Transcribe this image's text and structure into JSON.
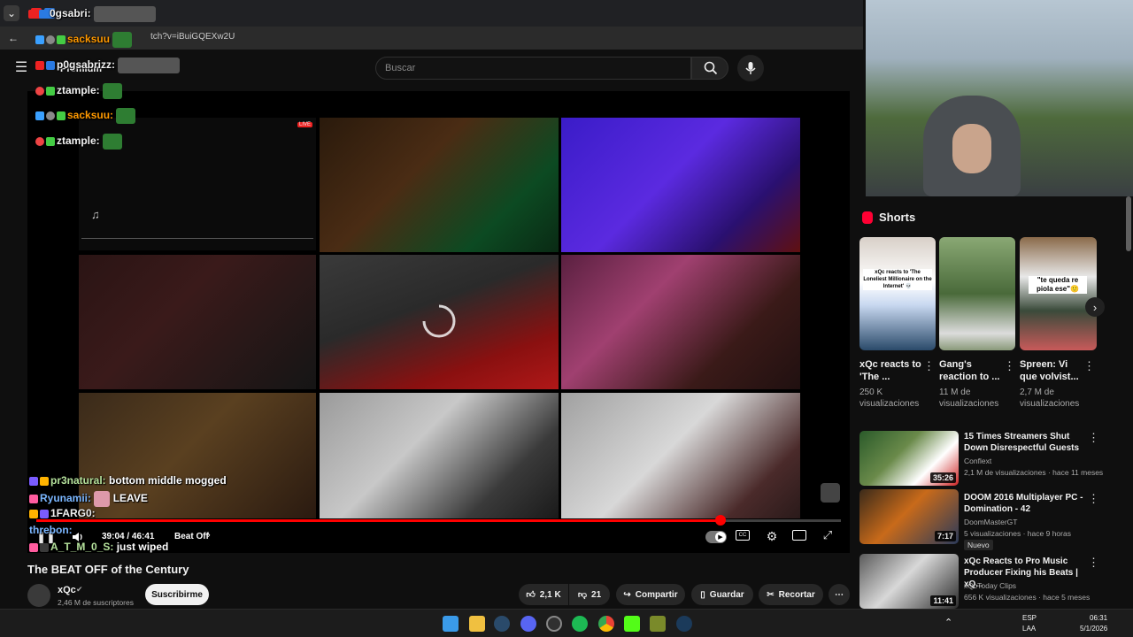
{
  "browser": {
    "tab_title": "0gsabri",
    "address": "tch?v=iBuiGQEXw2U"
  },
  "header": {
    "search_placeholder": "Buscar",
    "premium_label": "Premium"
  },
  "chat_top": [
    {
      "user": "0gsabri:",
      "color": "#ffffff"
    },
    {
      "user": "sacksuu",
      "color": "#ff9900"
    },
    {
      "user": "p0gsabrizz:",
      "color": "#ffffff"
    },
    {
      "user": "ztample:",
      "color": "#ffffff"
    },
    {
      "user": "sacksuu:",
      "color": "#ff9900"
    },
    {
      "user": "ztample:",
      "color": "#ffffff"
    }
  ],
  "chat_bottom": [
    {
      "user": "pr3natural:",
      "message": "bottom middle mogged",
      "color": "#b4e09b"
    },
    {
      "user": "Ryunamii:",
      "message": "LEAVE",
      "color": "#7ab6ff"
    },
    {
      "user": "1FARG0:",
      "message": "",
      "color": "#ffffff"
    },
    {
      "user": "threbon:",
      "message": "",
      "color": "#7ab6ff"
    },
    {
      "user": "A_T_M_0_S:",
      "message": "just wiped",
      "color": "#b4e09b"
    }
  ],
  "player": {
    "time": "39:04 / 46:41",
    "chapter": "Beat Off",
    "progress": 0.85,
    "live_badge": "LIVE"
  },
  "video": {
    "title": "The BEAT OFF of the Century",
    "channel": "xQc",
    "subscribers": "2,46 M de suscriptores",
    "subscribe_label": "Suscribirme",
    "likes": "2,1 K",
    "dislikes": "21",
    "share_label": "Compartir",
    "save_label": "Guardar",
    "clip_label": "Recortar"
  },
  "shorts": {
    "heading": "Shorts",
    "items": [
      {
        "title": "xQc reacts to 'The ...",
        "views": "250 K visualizaciones",
        "overlay": "xQc reacts to 'The Loneliest Millionaire on the Internet' 💀"
      },
      {
        "title": "Gang's reaction to ...",
        "views": "11 M de visualizaciones",
        "overlay": ""
      },
      {
        "title": "Spreen: Vi que volvist...",
        "views": "2,7 M de visualizaciones",
        "overlay": "\"te queda re piola ese\"🙂"
      }
    ]
  },
  "recommendations": [
    {
      "title": "15 Times Streamers Shut Down Disrespectful Guests",
      "channel": "Conflext",
      "meta": "2,1 M de visualizaciones · hace 11 meses",
      "duration": "35:26",
      "badge": ""
    },
    {
      "title": "DOOM 2016 Multiplayer PC - Domination - 42",
      "channel": "DoomMasterGT",
      "meta": "5 visualizaciones · hace 9 horas",
      "duration": "7:17",
      "badge": "Nuevo"
    },
    {
      "title": "xQc Reacts to Pro Music Producer Fixing his Beats | xQ...",
      "channel": "xQcToday Clips",
      "meta": "656 K visualizaciones · hace 5 meses",
      "duration": "11:41",
      "badge": ""
    }
  ],
  "taskbar": {
    "lang": "ESP",
    "lang2": "LAA",
    "time": "06:31",
    "date": "5/1/2026"
  },
  "colors": {
    "accent_red": "#ff0000",
    "bg": "#0f0f0f"
  }
}
